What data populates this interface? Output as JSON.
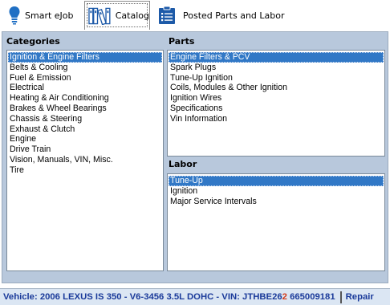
{
  "toolbar": {
    "tabs": [
      {
        "label": "Smart eJob",
        "icon": "lightbulb-icon"
      },
      {
        "label": "Catalog",
        "icon": "books-icon"
      },
      {
        "label": "Posted Parts and Labor",
        "icon": "clipboard-list-icon"
      }
    ],
    "active_tab": "Catalog"
  },
  "categories": {
    "title": "Categories",
    "items": [
      "Ignition & Engine Filters",
      "Belts & Cooling",
      "Fuel & Emission",
      "Electrical",
      "Heating & Air Conditioning",
      "Brakes & Wheel Bearings",
      "Chassis & Steering",
      "Exhaust & Clutch",
      "Engine",
      "Drive Train",
      "Vision, Manuals, VIN, Misc.",
      "Tire"
    ],
    "selected": "Ignition & Engine Filters"
  },
  "parts": {
    "title": "Parts",
    "items": [
      "Engine Filters & PCV",
      "Spark Plugs",
      "Tune-Up Ignition",
      "Coils, Modules & Other Ignition",
      "Ignition Wires",
      "Specifications",
      "Vin Information"
    ],
    "selected": "Engine Filters & PCV"
  },
  "labor": {
    "title": "Labor",
    "items": [
      "Tune-Up",
      "Ignition",
      "Major Service Intervals"
    ],
    "selected": "Tune-Up"
  },
  "status": {
    "vehicle_prefix": "Vehicle: 2006 LEXUS IS 350 - V6-3456 3.5L DOHC - VIN: JTHBE26",
    "vin_highlight": "2",
    "vehicle_suffix": " 665009181",
    "mode": "Repair"
  },
  "colors": {
    "panel_bg": "#b8c8dc",
    "selection": "#3178c6",
    "status_text": "#1a3a9a",
    "vin_highlight": "#d43a1a"
  }
}
